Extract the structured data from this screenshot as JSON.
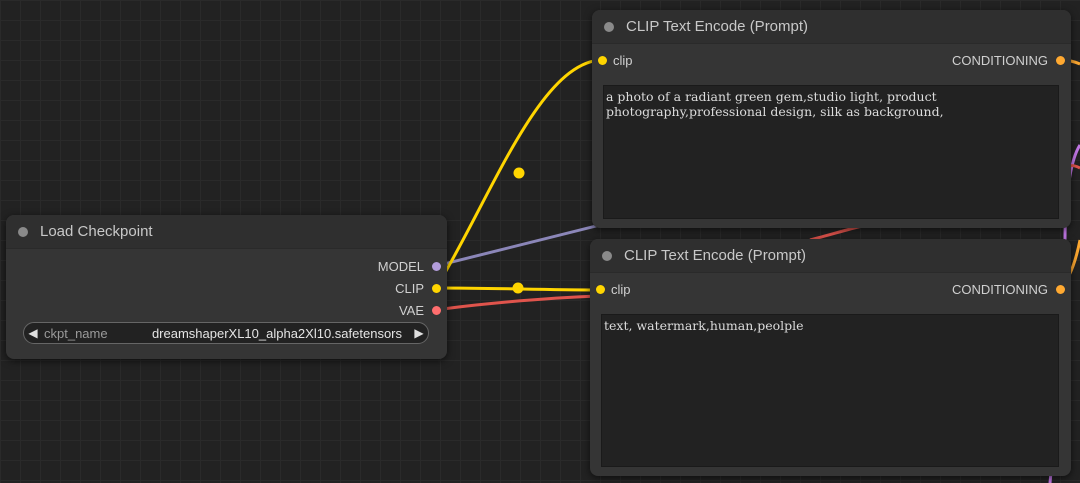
{
  "colors": {
    "clip": "#ffd500",
    "model": "#b39ddb",
    "vae": "#ff6e6e",
    "conditioning": "#ffa931",
    "link_purple": "#c277e6",
    "link_red": "#e0544c"
  },
  "load_checkpoint": {
    "title": "Load Checkpoint",
    "outputs": [
      "MODEL",
      "CLIP",
      "VAE"
    ],
    "widget": {
      "label": "ckpt_name",
      "value": "dreamshaperXL10_alpha2Xl10.safetensors"
    }
  },
  "clip_encode_positive": {
    "title": "CLIP Text Encode (Prompt)",
    "input": "clip",
    "output": "CONDITIONING",
    "text": "a photo of a radiant green gem,studio light, product\nphotography,professional design, silk as background,"
  },
  "clip_encode_negative": {
    "title": "CLIP Text Encode (Prompt)",
    "input": "clip",
    "output": "CONDITIONING",
    "text": "text, watermark,human,peolple"
  }
}
